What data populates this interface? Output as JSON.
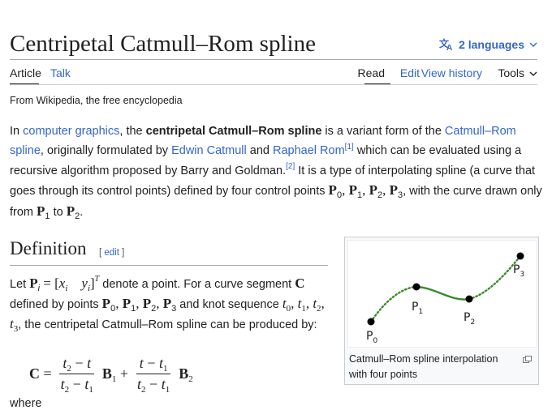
{
  "page": {
    "title": "Centripetal Catmull–Rom spline",
    "languages_label": "2 languages",
    "tagline": "From Wikipedia, the free encyclopedia"
  },
  "tabs": {
    "article": "Article",
    "talk": "Talk",
    "read": "Read",
    "edit": "Edit",
    "view_history": "View history",
    "tools": "Tools"
  },
  "intro": {
    "t1": "In ",
    "link_cg": "computer graphics",
    "t2": ", the ",
    "bold": "centripetal Catmull–Rom spline",
    "t3": " is a variant form of the ",
    "link_cr": "Catmull–Rom spline",
    "t4": ", originally formulated by ",
    "link_ec": "Edwin Catmull",
    "t5": " and ",
    "link_rr": "Raphael Rom",
    "ref1": "[1]",
    "t6": " which can be evaluated using a recursive algorithm proposed by Barry and Goldman.",
    "ref2": "[2]",
    "t7": " It is a type of interpolating spline (a curve that goes through its control points) defined by four control points ",
    "t8": ", with the curve drawn only from ",
    "t9": " to "
  },
  "definition": {
    "heading": "Definition",
    "edit_open": "[ ",
    "edit_label": "edit",
    "edit_close": " ]",
    "t1": "Let ",
    "t2": " denote a point. For a curve segment ",
    "t3": " defined by points ",
    "t4": " and knot sequence ",
    "t5": ", the centripetal Catmull–Rom spline can be produced by:",
    "where": "where"
  },
  "figure": {
    "caption": "Catmull–Rom spline interpolation with four points",
    "point_labels": [
      "P0",
      "P1",
      "P2",
      "P3"
    ]
  }
}
